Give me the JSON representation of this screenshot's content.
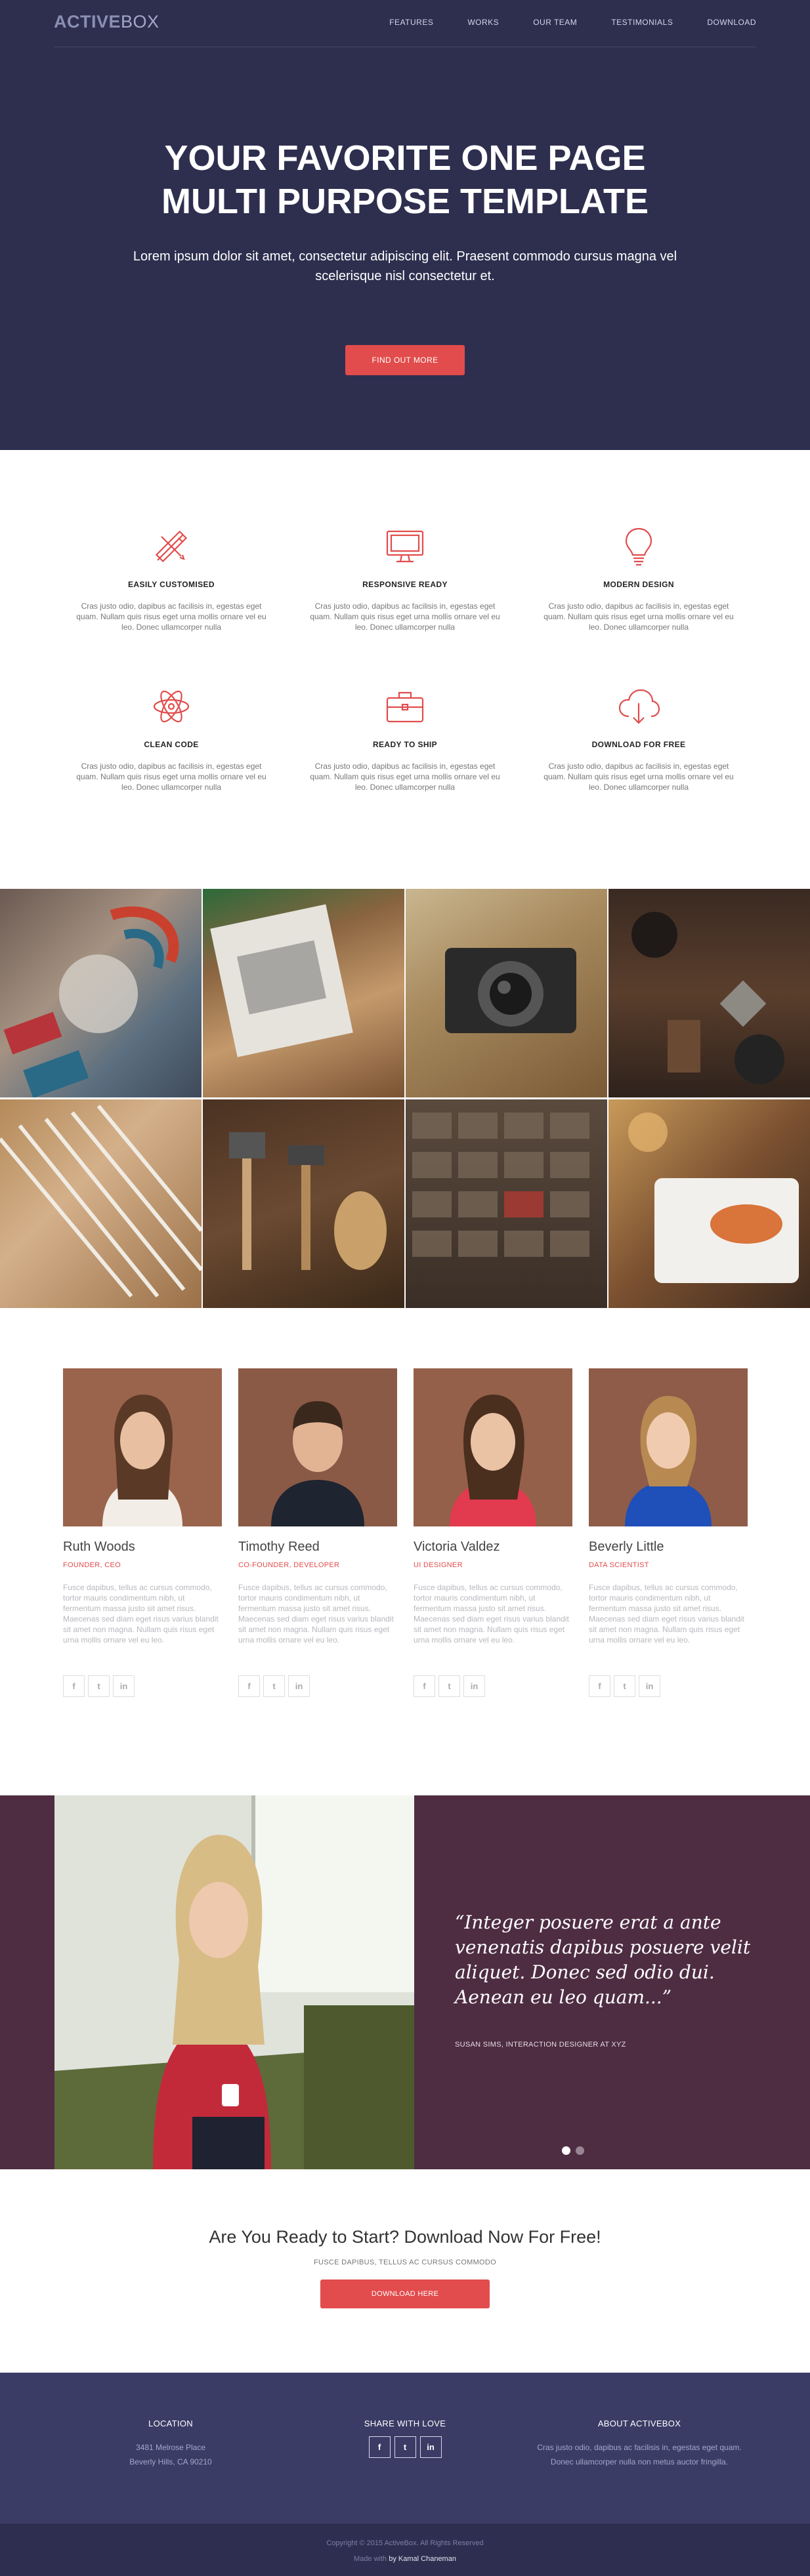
{
  "brand": {
    "logo_part1": "ACTIVE",
    "logo_part2": "BOX"
  },
  "nav": {
    "items": [
      "FEATURES",
      "WORKS",
      "OUR TEAM",
      "TESTIMONIALS",
      "DOWNLOAD"
    ]
  },
  "hero": {
    "title_line1": "YOUR FAVORITE ONE PAGE",
    "title_line2": "MULTI PURPOSE TEMPLATE",
    "lead": "Lorem ipsum dolor sit amet, consectetur adipiscing elit. Praesent commodo cursus magna vel scelerisque nisl consectetur et.",
    "cta_label": "FIND OUT MORE"
  },
  "features": [
    {
      "icon": "pencil-ruler-icon",
      "title": "EASILY CUSTOMISED",
      "text": "Cras justo odio, dapibus ac facilisis in, egestas eget quam. Nullam quis risus eget urna mollis ornare vel eu leo. Donec ullamcorper nulla"
    },
    {
      "icon": "monitor-icon",
      "title": "RESPONSIVE READY",
      "text": "Cras justo odio, dapibus ac facilisis in, egestas eget quam. Nullam quis risus eget urna mollis ornare vel eu leo. Donec ullamcorper nulla"
    },
    {
      "icon": "lightbulb-icon",
      "title": "MODERN DESIGN",
      "text": "Cras justo odio, dapibus ac facilisis in, egestas eget quam. Nullam quis risus eget urna mollis ornare vel eu leo. Donec ullamcorper nulla"
    },
    {
      "icon": "atom-icon",
      "title": "CLEAN CODE",
      "text": "Cras justo odio, dapibus ac facilisis in, egestas eget quam. Nullam quis risus eget urna mollis ornare vel eu leo. Donec ullamcorper nulla"
    },
    {
      "icon": "briefcase-icon",
      "title": "READY TO SHIP",
      "text": "Cras justo odio, dapibus ac facilisis in, egestas eget quam. Nullam quis risus eget urna mollis ornare vel eu leo. Donec ullamcorper nulla"
    },
    {
      "icon": "cloud-download-icon",
      "title": "DOWNLOAD FOR FREE",
      "text": "Cras justo odio, dapibus ac facilisis in, egestas eget quam. Nullam quis risus eget urna mollis ornare vel eu leo. Donec ullamcorper nulla"
    }
  ],
  "team": [
    {
      "name": "Ruth Woods",
      "role": "FOUNDER, CEO",
      "bio": "Fusce dapibus, tellus ac cursus commodo, tortor mauris condimentum nibh, ut fermentum massa justo sit amet risus. Maecenas sed diam eget risus varius blandit sit amet non magna. Nullam quis risus eget urna mollis ornare vel eu leo."
    },
    {
      "name": "Timothy Reed",
      "role": "CO-FOUNDER, DEVELOPER",
      "bio": "Fusce dapibus, tellus ac cursus commodo, tortor mauris condimentum nibh, ut fermentum massa justo sit amet risus. Maecenas sed diam eget risus varius blandit sit amet non magna. Nullam quis risus eget urna mollis ornare vel eu leo."
    },
    {
      "name": "Victoria Valdez",
      "role": "UI DESIGNER",
      "bio": "Fusce dapibus, tellus ac cursus commodo, tortor mauris condimentum nibh, ut fermentum massa justo sit amet risus. Maecenas sed diam eget risus varius blandit sit amet non magna. Nullam quis risus eget urna mollis ornare vel eu leo."
    },
    {
      "name": "Beverly Little",
      "role": "DATA SCIENTIST",
      "bio": "Fusce dapibus, tellus ac cursus commodo, tortor mauris condimentum nibh, ut fermentum massa justo sit amet risus. Maecenas sed diam eget risus varius blandit sit amet non magna. Nullam quis risus eget urna mollis ornare vel eu leo."
    }
  ],
  "social_icons": {
    "facebook": "f",
    "twitter": "t",
    "linkedin": "in"
  },
  "testimonial": {
    "quote": "“Integer posuere erat a ante venenatis dapibus posuere velit aliquet. Donec sed odio dui. Aenean eu leo quam...”",
    "author": "SUSAN SIMS, INTERACTION DESIGNER AT XYZ"
  },
  "download": {
    "title": "Are You Ready to Start? Download Now For Free!",
    "subtitle": "FUSCE DAPIBUS, TELLUS AC CURSUS COMMODO",
    "button_label": "DOWNLOAD HERE"
  },
  "footer": {
    "location_title": "LOCATION",
    "location_line1": "3481 Melrose Place",
    "location_line2": "Beverly Hills, CA 90210",
    "share_title": "SHARE WITH LOVE",
    "about_title": "ABOUT ACTIVEBOX",
    "about_text": "Cras justo odio, dapibus ac facilisis in, egestas eget quam. Donec ullamcorper nulla non metus auctor fringilla.",
    "copyright": "Copyright © 2015 ActiveBox. All Rights Reserved",
    "made_with": "Made with",
    "made_by": "by Kamal Chaneman"
  },
  "colors": {
    "hero_bg": "#2e2f4f",
    "accent": "#e24c4c",
    "testimonial_bg": "#4e2d43",
    "footer_bg": "#3b3c66"
  }
}
